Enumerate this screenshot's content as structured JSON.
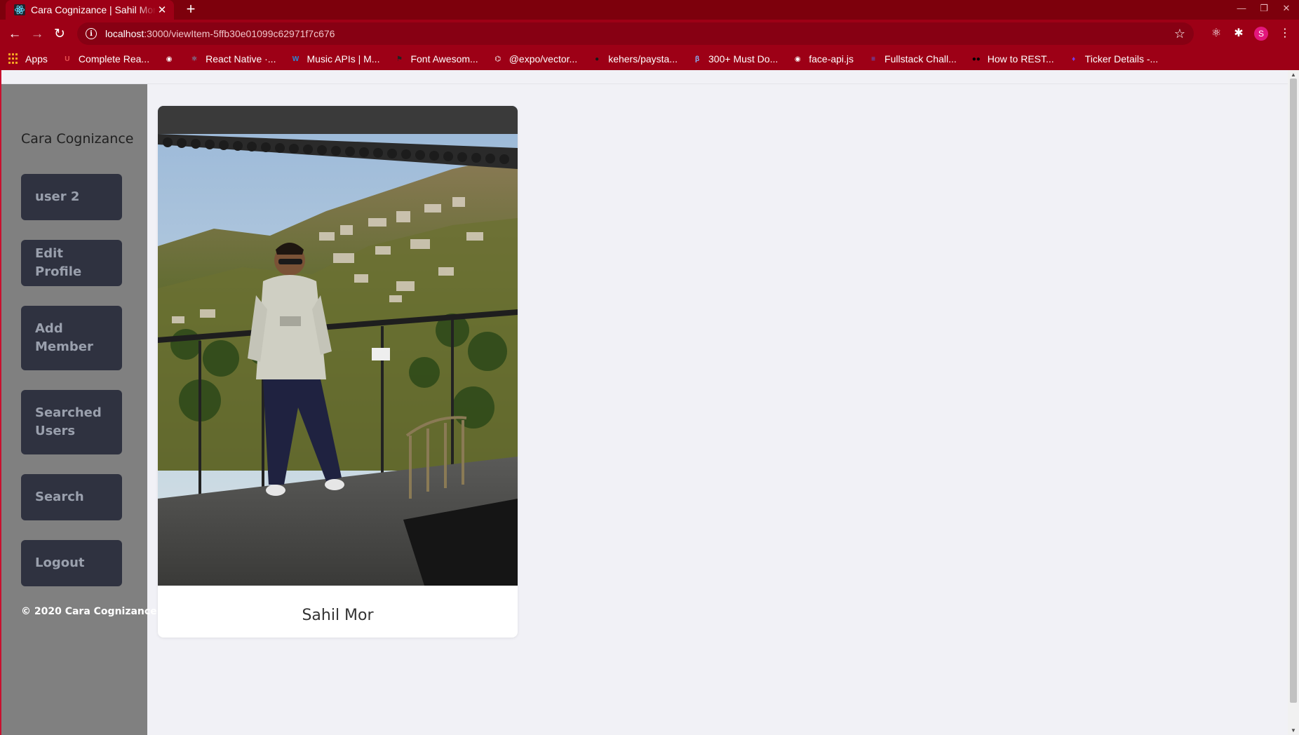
{
  "browser": {
    "tab_title": "Cara Cognizance | Sahil Mor",
    "new_tab_label": "+",
    "url_host": "localhost",
    "url_path": ":3000/viewItem-5ffb30e01099c62971f7c676",
    "profile_initial": "S",
    "bookmarks": [
      {
        "label": "Apps",
        "icon": "apps-grid-icon",
        "color": "#f5a623"
      },
      {
        "label": "Complete Rea...",
        "icon": "udemy-icon",
        "color": "#ec5252"
      },
      {
        "label": "",
        "icon": "globe-icon",
        "color": "#ffffff"
      },
      {
        "label": "React Native ·...",
        "icon": "react-icon",
        "color": "#61dafb"
      },
      {
        "label": "Music APIs | M...",
        "icon": "wordpress-icon",
        "color": "#2a8bd8"
      },
      {
        "label": "Font Awesom...",
        "icon": "flag-icon",
        "color": "#222222"
      },
      {
        "label": "@expo/vector...",
        "icon": "expo-icon",
        "color": "#ffffff"
      },
      {
        "label": "kehers/paysta...",
        "icon": "github-icon",
        "color": "#181717"
      },
      {
        "label": "300+ Must Do...",
        "icon": "beta-icon",
        "color": "#8ab4f8"
      },
      {
        "label": "face-api.js",
        "icon": "globe-icon",
        "color": "#ffffff"
      },
      {
        "label": "Fullstack Chall...",
        "icon": "doc-icon",
        "color": "#4c6ef5"
      },
      {
        "label": "How to REST...",
        "icon": "medium-icon",
        "color": "#000000"
      },
      {
        "label": "Ticker Details -...",
        "icon": "bulb-icon",
        "color": "#7c3aed"
      }
    ]
  },
  "sidebar": {
    "brand": "Cara Cognizance",
    "items": [
      {
        "label": "user 2"
      },
      {
        "label": "Edit Profile"
      },
      {
        "label": "Add Member"
      },
      {
        "label": "Searched Users"
      },
      {
        "label": "Search"
      },
      {
        "label": "Logout"
      }
    ],
    "copyright": "© 2020 Cara Cognizance"
  },
  "main": {
    "card": {
      "name": "Sahil Mor",
      "image_alt": "Profile photo of a person standing on a balcony overlooking a hillside town"
    }
  },
  "colors": {
    "browser_frame": "#9d0016",
    "sidebar_bg": "#808080",
    "nav_button_bg": "#2f3240",
    "nav_button_text": "#9aa0ad",
    "page_bg": "#f1f1f6",
    "accent_rail": "#c8102e"
  }
}
